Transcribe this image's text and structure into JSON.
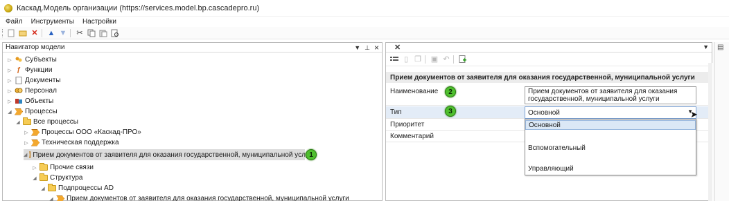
{
  "window": {
    "title": "Каскад.Модель организации (https://services.model.bp.cascadepro.ru)"
  },
  "menu": [
    "Файл",
    "Инструменты",
    "Настройки"
  ],
  "navigator": {
    "title": "Навигатор модели",
    "pin_glyph": "⊥",
    "close_glyph": "×",
    "dropdown_glyph": "▼",
    "items": [
      {
        "label": "Субъекты",
        "icon": "subjects-icon"
      },
      {
        "label": "Функции",
        "icon": "functions-icon"
      },
      {
        "label": "Документы",
        "icon": "documents-icon"
      },
      {
        "label": "Персонал",
        "icon": "personnel-icon"
      },
      {
        "label": "Объекты",
        "icon": "objects-icon"
      },
      {
        "label": "Процессы",
        "icon": "processes-icon"
      },
      {
        "label": "Все процессы",
        "icon": "folder-icon"
      },
      {
        "label": "Процессы ООО «Каскад-ПРО»",
        "icon": "process-icon"
      },
      {
        "label": "Техническая поддержка",
        "icon": "process-icon"
      },
      {
        "label": "Прием документов от заявителя для оказания государственной, муниципальной услуги",
        "icon": "process-icon"
      },
      {
        "label": "Прочие связи",
        "icon": "folder-icon"
      },
      {
        "label": "Структура",
        "icon": "folder-icon"
      },
      {
        "label": "Подпроцессы AD",
        "icon": "folder-icon"
      },
      {
        "label": "Прием документов от заявителя для оказания государственной, муниципальной услуги",
        "icon": "process-icon"
      }
    ]
  },
  "badges": [
    "1",
    "2",
    "3"
  ],
  "editor": {
    "tab_close_glyph": "✕",
    "section_title": "Прием документов от заявителя для оказания государственной, муниципальной услуги",
    "properties": {
      "name_label": "Наименование",
      "name_value_line1": "Прием документов от заявителя для оказания",
      "name_value_line2": "государственной, муниципальной услуги",
      "type_label": "Тип",
      "type_value": "Основной",
      "priority_label": "Приоритет",
      "comment_label": "Комментарий"
    },
    "type_options": [
      "Основной",
      "Вспомогательный",
      "Управляющий"
    ]
  },
  "colors": {
    "badge": "#4fbf2f",
    "selection": "#dcdcdc",
    "dropdown_active": "#dbe8f6"
  }
}
